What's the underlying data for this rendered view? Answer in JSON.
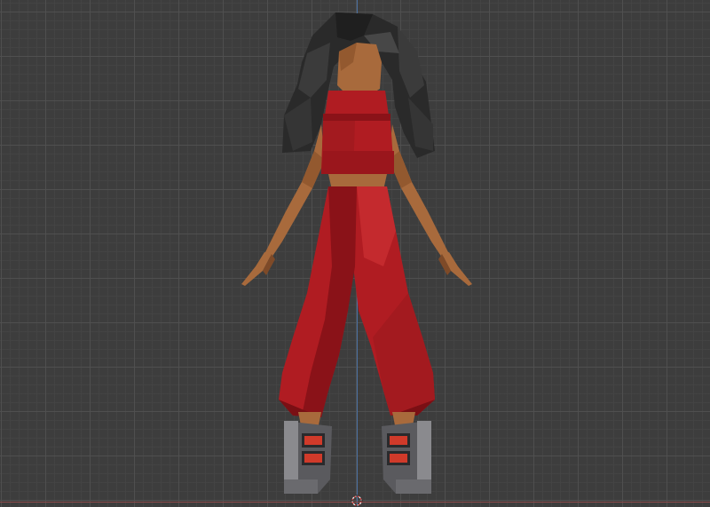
{
  "viewport": {
    "background": "#3d3d3d",
    "grid_major": "#505050",
    "grid_minor": "#444444",
    "axis_z_color": "#4a6fa0",
    "axis_x_color": "#8a4a4a"
  },
  "model": {
    "skin": "#a86a3c",
    "skin_shadow": "#7e4a28",
    "hair": "#2a2a2a",
    "hair_light": "#3b3b3b",
    "outfit": "#b01c22",
    "outfit_dark": "#8a1218",
    "outfit_light": "#c42a2e",
    "boot": "#5a5a5e",
    "boot_light": "#8a8a8e",
    "boot_strap": "#d03a2a"
  },
  "icons": {
    "cursor": "3d-cursor-icon"
  }
}
